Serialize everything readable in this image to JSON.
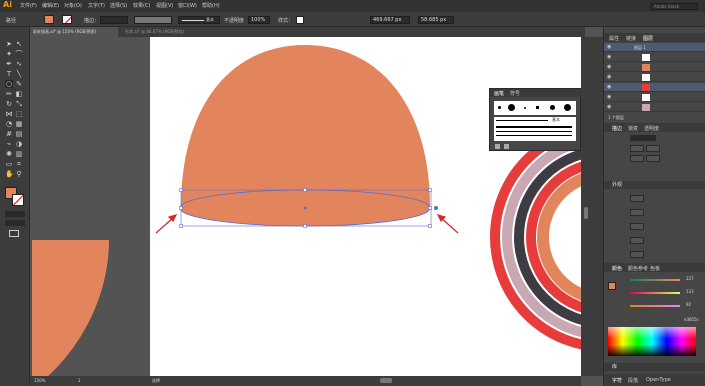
{
  "app": {
    "logo": "Ai",
    "menus": [
      "文件(F)",
      "编辑(E)",
      "对象(O)",
      "文字(T)",
      "选择(S)",
      "效果(C)",
      "视图(V)",
      "窗口(W)",
      "帮助(H)"
    ],
    "search_placeholder": "Adobe Stock"
  },
  "options": {
    "selection_label": "路径",
    "stroke_label": "描边：",
    "stroke_value": "",
    "profile_label": "基本",
    "opacity_label": "不透明度",
    "opacity_value": "100%",
    "style_label": "样式：",
    "width_value": "469.667 px",
    "height_value": "58.685 px"
  },
  "tabs": [
    {
      "label": "彩虹插画.ai* @ 150% (RGB/预览)"
    },
    {
      "label": "形状.ai* @ 66.67% (RGB/预览)"
    }
  ],
  "status": {
    "zoom": "150%",
    "page": "1",
    "mode": "选择"
  },
  "brush_panel": {
    "tab1": "画笔",
    "tab2": "符号",
    "stroke_label": "基本"
  },
  "layers_panel": {
    "tabs": [
      "属性",
      "链接",
      "图层"
    ],
    "layer_name": "图层 1",
    "count": "1 个图层"
  },
  "transform_panel": {
    "tabs": [
      "描边",
      "渐变",
      "透明度"
    ]
  },
  "appearance_panel": {
    "title": "外观"
  },
  "color_panel": {
    "tabs": [
      "颜色",
      "颜色参考",
      "色板"
    ],
    "r": "227",
    "g": "133",
    "b": "92",
    "hex": "e3855c"
  },
  "libraries": {
    "tabs": [
      "字符",
      "段落",
      "OpenType"
    ],
    "title": "库"
  },
  "colors": {
    "fill": "#e3855c",
    "ring_red": "#e63c3c",
    "ring_pink": "#c9a7b3",
    "ring_dark": "#3c3c42"
  }
}
